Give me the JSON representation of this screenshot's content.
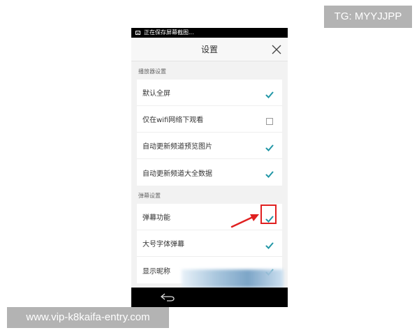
{
  "watermarks": {
    "tg": "TG: MYYJJPP",
    "url": "www.vip-k8kaifa-entry.com"
  },
  "status_bar": {
    "icon": "image-icon",
    "text": "正在保存屏幕截图..."
  },
  "header": {
    "title": "设置",
    "close_icon": "close-icon"
  },
  "sections": [
    {
      "title": "播放器设置",
      "items": [
        {
          "label": "默认全屏",
          "checked": true
        },
        {
          "label": "仅在wifi网络下观看",
          "checked": false
        },
        {
          "label": "自动更新频道预览图片",
          "checked": true
        },
        {
          "label": "自动更新频道大全数据",
          "checked": true
        }
      ]
    },
    {
      "title": "弹幕设置",
      "items": [
        {
          "label": "弹幕功能",
          "checked": true,
          "highlighted": true
        },
        {
          "label": "大号字体弹幕",
          "checked": true
        },
        {
          "label": "显示昵称",
          "checked": true
        }
      ]
    }
  ],
  "nav_bar": {
    "back_icon": "back-arrow-icon"
  },
  "colors": {
    "check": "#2196a6",
    "highlight": "#e02020",
    "background": "#f2f2f2"
  }
}
